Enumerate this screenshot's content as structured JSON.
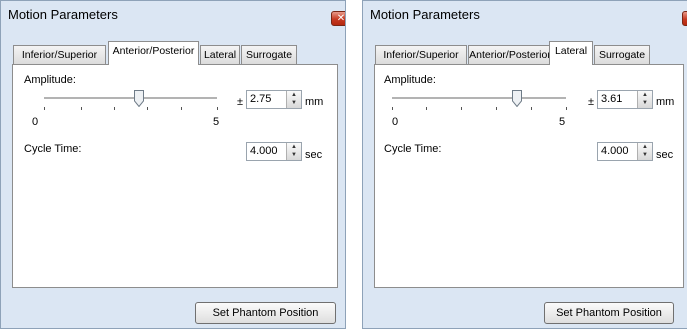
{
  "windows": [
    {
      "title": "Motion Parameters",
      "close_glyph": "✕",
      "tabs": [
        "Inferior/Superior",
        "Anterior/Posterior",
        "Lateral",
        "Surrogate"
      ],
      "active_tab": "Anterior/Posterior",
      "amplitude_label": "Amplitude:",
      "amplitude_prefix": "±",
      "amplitude_value": "2.75",
      "amplitude_unit": "mm",
      "slider_min_label": "0",
      "slider_max_label": "5",
      "slider_level_fraction": 0.55,
      "cycle_label": "Cycle Time:",
      "cycle_value": "4.000",
      "cycle_unit": "sec",
      "button_label": "Set Phantom Position"
    },
    {
      "title": "Motion Parameters",
      "close_glyph": "✕",
      "tabs": [
        "Inferior/Superior",
        "Anterior/Posterior",
        "Lateral",
        "Surrogate"
      ],
      "active_tab": "Lateral",
      "amplitude_label": "Amplitude:",
      "amplitude_prefix": "±",
      "amplitude_value": "3.61",
      "amplitude_unit": "mm",
      "slider_min_label": "0",
      "slider_max_label": "5",
      "slider_level_fraction": 0.72,
      "cycle_label": "Cycle Time:",
      "cycle_value": "4.000",
      "cycle_unit": "sec",
      "button_label": "Set Phantom Position"
    }
  ],
  "icons": {
    "close": "close-icon",
    "spin_up": "spin-up-icon",
    "spin_down": "spin-down-icon",
    "slider_thumb": "slider-thumb"
  }
}
